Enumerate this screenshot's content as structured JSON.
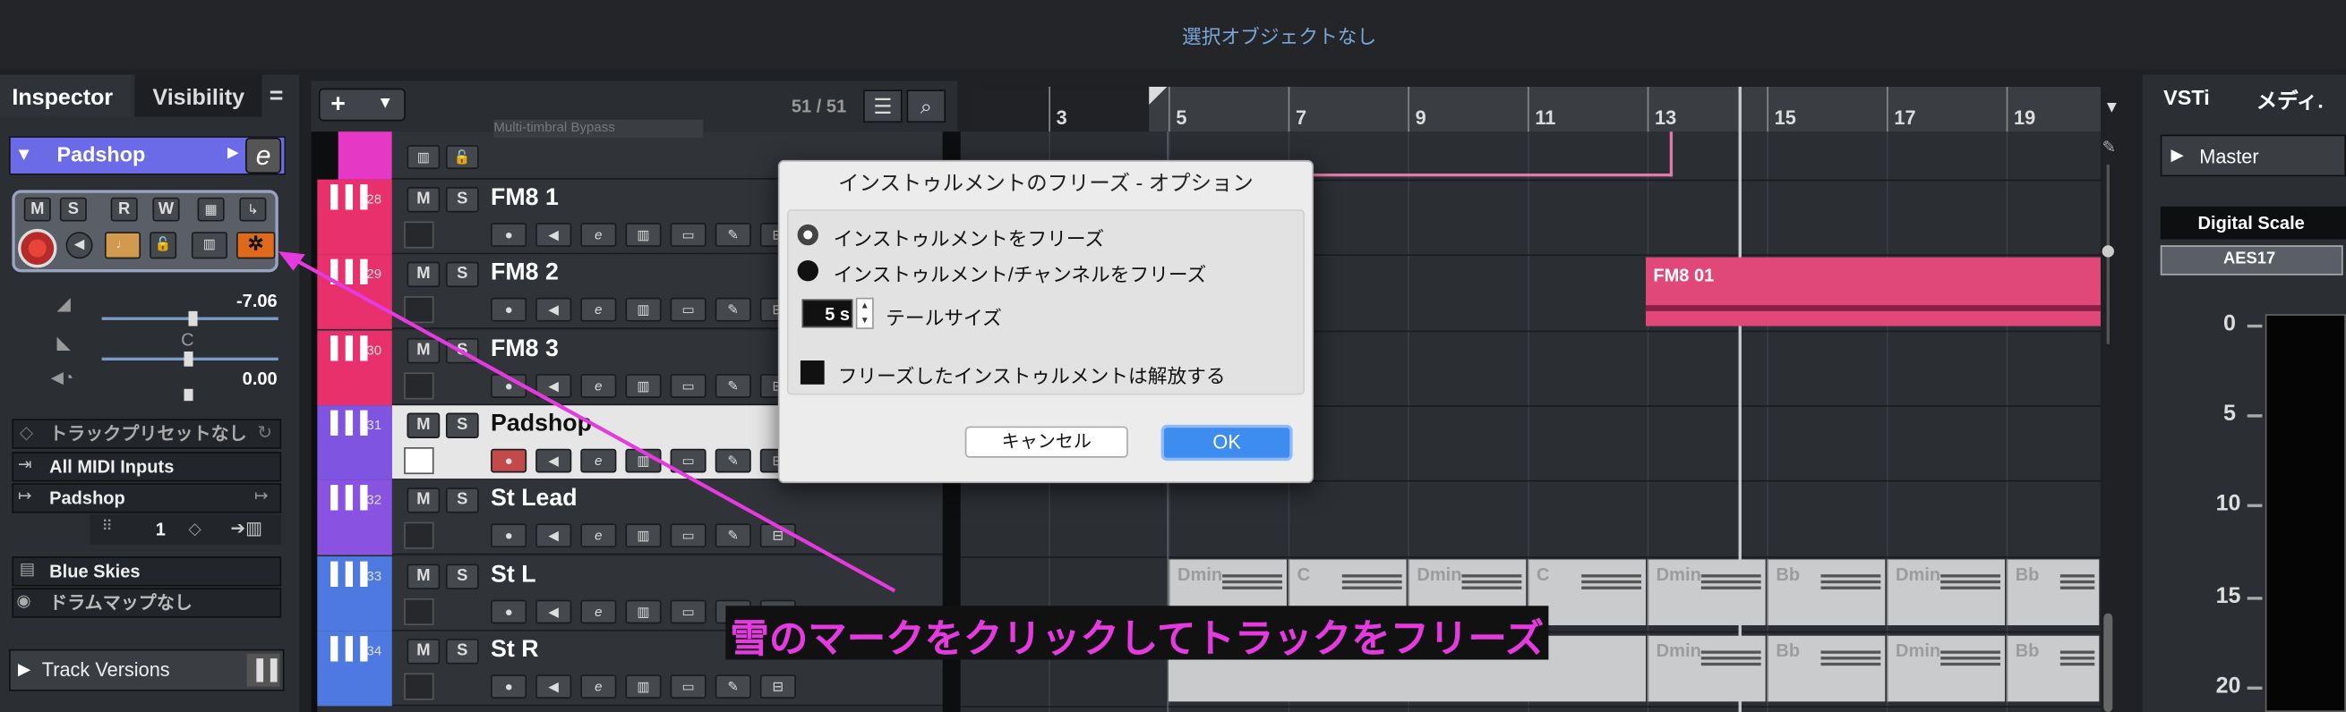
{
  "window": {
    "title": "選択オブジェクトなし"
  },
  "inspector": {
    "tab_inspector": "Inspector",
    "tab_visibility": "Visibility",
    "menu_icon": "=",
    "track_name": "Padshop",
    "volume": "-7.06",
    "pan_label": "C",
    "pan_value": "0.00",
    "preset": "トラックプリセットなし",
    "midi_input": "All MIDI Inputs",
    "output": "Padshop",
    "channel": "1",
    "expression": "Blue Skies",
    "drum_map": "ドラムマップなし",
    "track_versions": "Track Versions"
  },
  "toolbar": {
    "counter": "51 / 51",
    "add_label": "+"
  },
  "ruler": {
    "marks": [
      "3",
      "5",
      "7",
      "9",
      "11",
      "13",
      "15",
      "17",
      "19"
    ]
  },
  "tracks": [
    {
      "num": "28",
      "name": "FM8 1",
      "color": "#e8306c"
    },
    {
      "num": "29",
      "name": "FM8 2",
      "color": "#e8306c"
    },
    {
      "num": "30",
      "name": "FM8 3",
      "color": "#e8306c"
    },
    {
      "num": "31",
      "name": "Padshop",
      "color": "#7f54e0"
    },
    {
      "num": "32",
      "name": "St Lead",
      "color": "#8a52e0"
    },
    {
      "num": "33",
      "name": "St L",
      "color": "#4d79e0"
    },
    {
      "num": "34",
      "name": "St R",
      "color": "#4d79e0"
    }
  ],
  "top_label": "Multi-timbral Bypass",
  "events": {
    "fm8_part": "FM8 01"
  },
  "chords_st_l": [
    "Dmin",
    "C",
    "Dmin",
    "C",
    "Dmin",
    "Bb",
    "Dmin",
    "Bb"
  ],
  "chords_st_r": [
    "Dmin",
    "Bb",
    "Dmin",
    "Bb"
  ],
  "dialog": {
    "title": "インストゥルメントのフリーズ - オプション",
    "option1": "インストゥルメントをフリーズ",
    "option2": "インストゥルメント/チャンネルをフリーズ",
    "tail_value": "5 s",
    "tail_label": "テールサイズ",
    "checkbox_label": "フリーズしたインストゥルメントは解放する",
    "cancel": "キャンセル",
    "ok": "OK"
  },
  "annotation": "雪のマークをクリックしてトラックをフリーズ",
  "right_panel": {
    "tab_vsti": "VSTi",
    "tab_media": "メディ.",
    "master": "Master",
    "digital_scale": "Digital Scale",
    "aes": "AES17",
    "scale": [
      "0",
      "5",
      "10",
      "15",
      "20"
    ]
  }
}
